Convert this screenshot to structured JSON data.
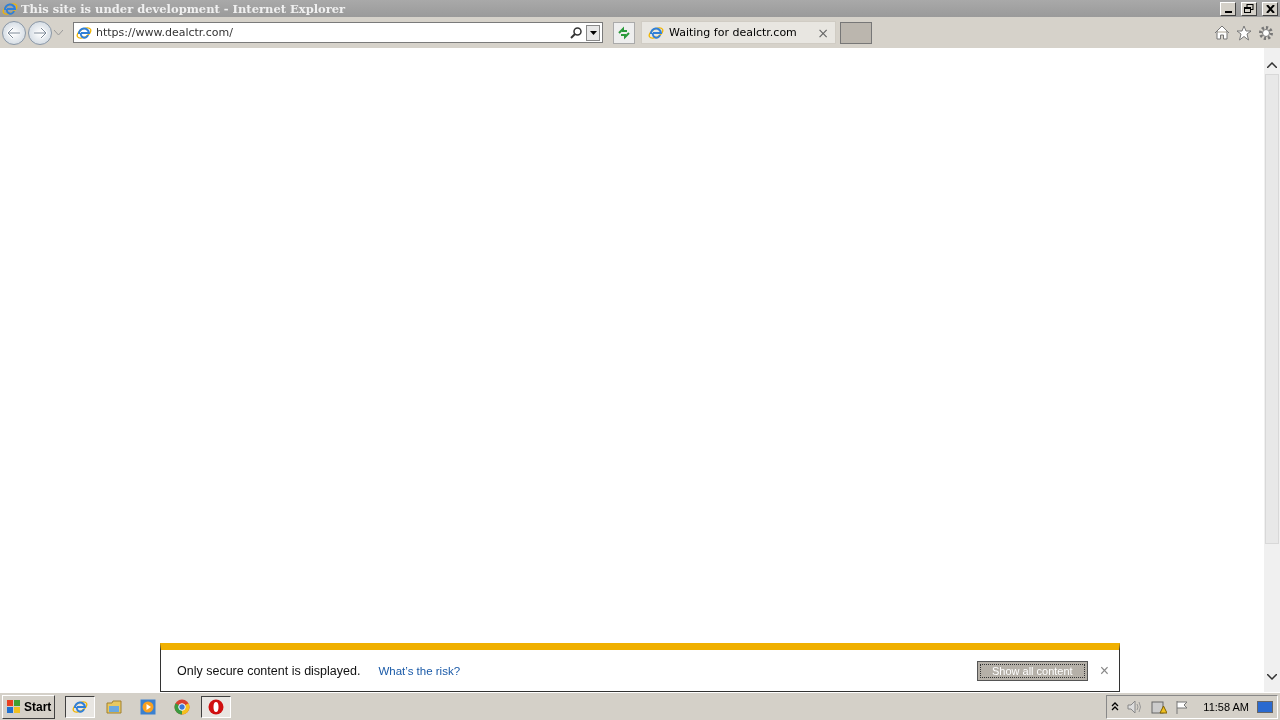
{
  "window": {
    "title": "This site is under development - Internet Explorer"
  },
  "address_bar": {
    "url": "https://www.dealctr.com/"
  },
  "tabs": [
    {
      "label": "Waiting for dealctr.com",
      "selected": true,
      "close": "×"
    }
  ],
  "notification_bar": {
    "message": "Only secure content is displayed.",
    "link": "What’s the risk?",
    "button": "Show all content",
    "close": "×"
  },
  "taskbar": {
    "start": "Start",
    "apps": [
      {
        "kind": "ie",
        "selected": true
      },
      {
        "kind": "folder",
        "selected": false
      },
      {
        "kind": "media",
        "selected": false
      },
      {
        "kind": "chrome",
        "selected": false
      },
      {
        "kind": "opera",
        "selected": true
      }
    ],
    "clock": "11:58 AM"
  }
}
